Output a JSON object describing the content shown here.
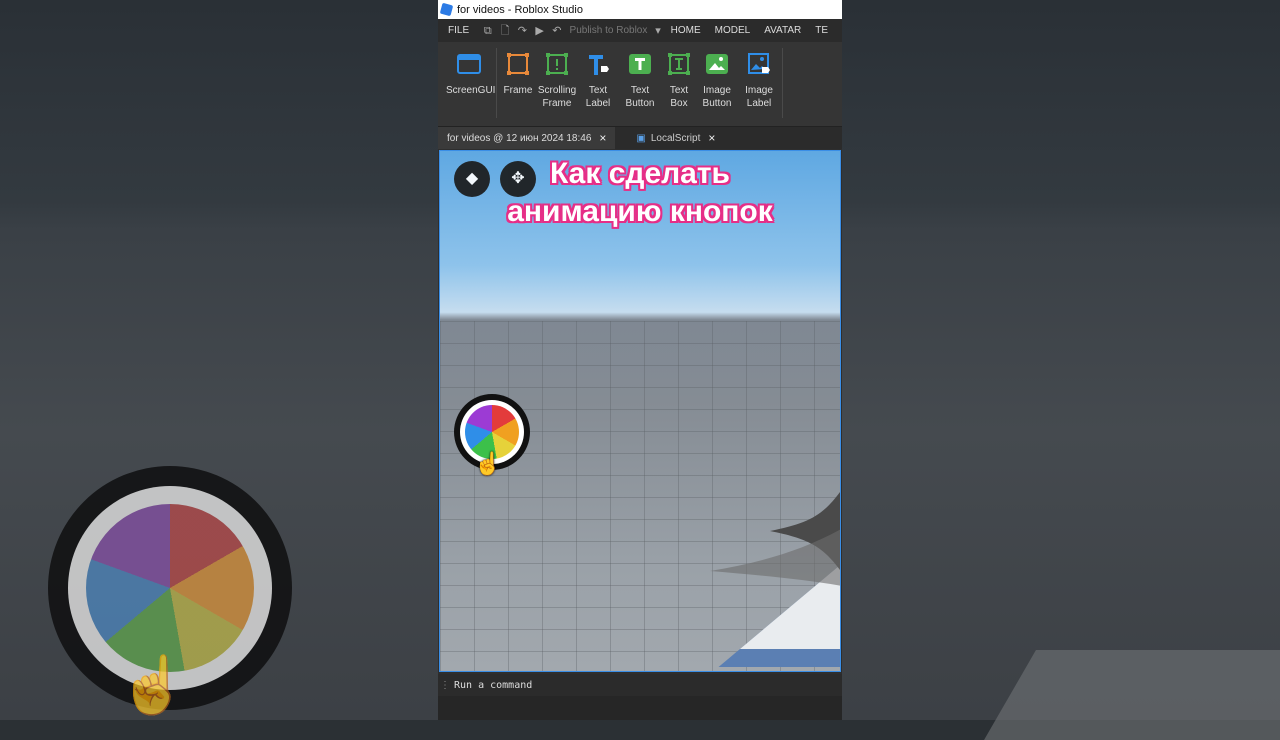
{
  "window": {
    "title": "for videos - Roblox Studio"
  },
  "menubar": {
    "file": "FILE",
    "publish": "Publish to Roblox",
    "tabs": [
      "HOME",
      "MODEL",
      "AVATAR",
      "TE"
    ]
  },
  "ribbon": {
    "tools": [
      {
        "label": [
          "ScreenGUI",
          ""
        ],
        "icon": "screengui-icon"
      },
      {
        "label": [
          "Frame",
          ""
        ],
        "icon": "frame-icon"
      },
      {
        "label": [
          "Scrolling",
          "Frame"
        ],
        "icon": "scrolling-frame-icon"
      },
      {
        "label": [
          "Text",
          "Label"
        ],
        "icon": "text-label-icon"
      },
      {
        "label": [
          "Text",
          "Button"
        ],
        "icon": "text-button-icon"
      },
      {
        "label": [
          "Text",
          "Box"
        ],
        "icon": "text-box-icon"
      },
      {
        "label": [
          "Image",
          "Button"
        ],
        "icon": "image-button-icon"
      },
      {
        "label": [
          "Image",
          "Label"
        ],
        "icon": "image-label-icon"
      }
    ]
  },
  "doc_tabs": [
    {
      "label": "for videos @ 12 июн 2024 18:46",
      "close": "×"
    },
    {
      "label": "LocalScript",
      "close": "×"
    }
  ],
  "viewport": {
    "heading_line1": "Как сделать",
    "heading_line2": "анимацию кнопок"
  },
  "command_bar": {
    "placeholder": "Run a command"
  },
  "colors": {
    "accent": "#3a8ee6",
    "heading_stroke": "#e62e87",
    "tool_orange": "#e8893a",
    "tool_green": "#4caf50",
    "tool_blue": "#2f8ee8"
  }
}
